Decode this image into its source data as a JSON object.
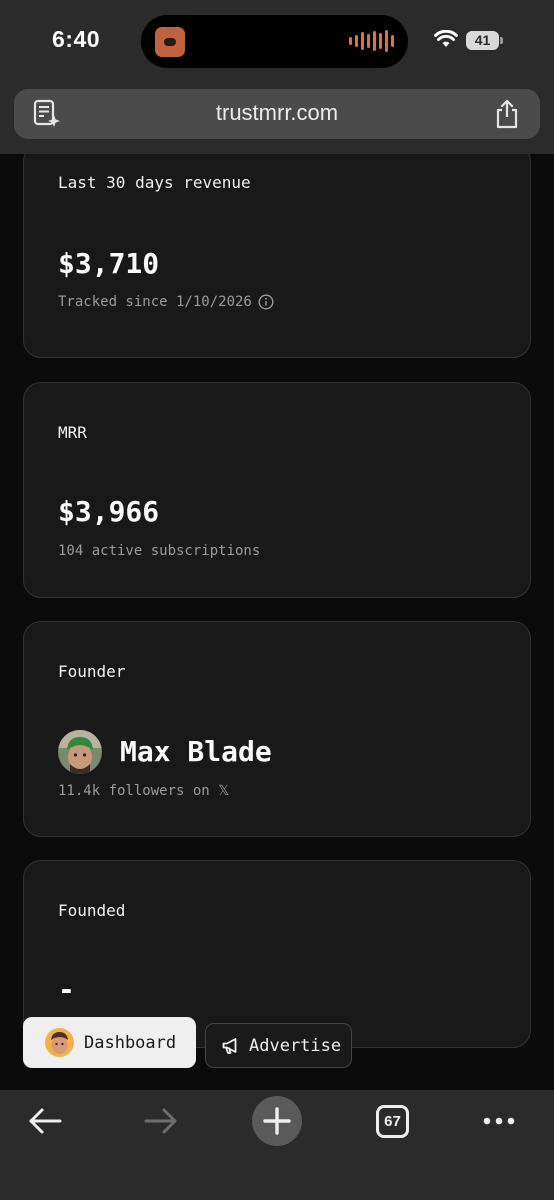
{
  "status_bar": {
    "time": "6:40",
    "battery": "41"
  },
  "browser": {
    "url": "trustmrr.com",
    "tab_count": "67"
  },
  "cards": {
    "revenue": {
      "label": "Last 30 days revenue",
      "value": "$3,710",
      "sub": "Tracked since 1/10/2026"
    },
    "mrr": {
      "label": "MRR",
      "value": "$3,966",
      "sub": "104 active subscriptions"
    },
    "founder": {
      "label": "Founder",
      "name": "Max Blade",
      "sub": "11.4k followers on 𝕏"
    },
    "founded": {
      "label": "Founded",
      "value": "-"
    }
  },
  "actions": {
    "dashboard": "Dashboard",
    "advertise": "Advertise"
  },
  "icons": {
    "reader": "reader-sparkle-icon",
    "share": "share-icon",
    "info": "info-icon",
    "megaphone": "megaphone-icon",
    "back": "arrow-left-icon",
    "forward": "arrow-right-icon",
    "new_tab": "plus-icon",
    "more": "more-dots-icon"
  },
  "colors": {
    "page_bg": "#0b0b0b",
    "card_bg": "#191919",
    "chrome_bg": "#2b2b2b",
    "accent_orange": "#e0704a"
  }
}
